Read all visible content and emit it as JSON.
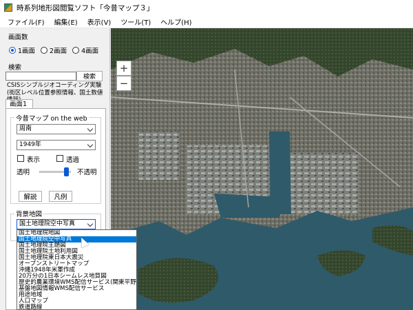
{
  "window": {
    "title": "時系列地形図閲覧ソフト「今昔マップ３」"
  },
  "menu": [
    "ファイル(F)",
    "編集(E)",
    "表示(V)",
    "ツール(T)",
    "ヘルプ(H)"
  ],
  "screen_count": {
    "title": "画面数",
    "options": [
      "1画面",
      "2画面",
      "4画面"
    ],
    "selected": "1画面"
  },
  "search": {
    "title": "検索",
    "value": "",
    "button_label": "検索",
    "note": "CSISシンプルジオコーディング実験(街区レベル位置参照情報、国土数値情報)"
  },
  "tab": {
    "label": "画面1"
  },
  "konjaku": {
    "title": "今昔マップ on the web",
    "region": "周南",
    "year": "1949年",
    "show_label": "表示",
    "transparent_label": "透過",
    "opaque_label": "透明",
    "nontransparent_label": "不透明",
    "slider_value": 0.8,
    "commentary_button": "解説",
    "legend_button": "凡例"
  },
  "background": {
    "title": "背景地図",
    "selected": "国土地理院空中写真",
    "options": [
      "国土地理院地図",
      "国土地理院空中写真",
      "国土地理院主題図",
      "国土地理院土地利用図",
      "国土地理院東日本大震災",
      "オープンストリートマップ",
      "沖縄1948年米軍作成",
      "20万分の1日本シームレス地質図",
      "歴史的農業環境WMS配信サービス(関東平野)",
      "基盤地図情報WMS配信サービス",
      "用途地域",
      "人口マップ",
      "鉄道路線"
    ]
  },
  "map": {
    "zoom_in": "+",
    "zoom_out": "−"
  }
}
